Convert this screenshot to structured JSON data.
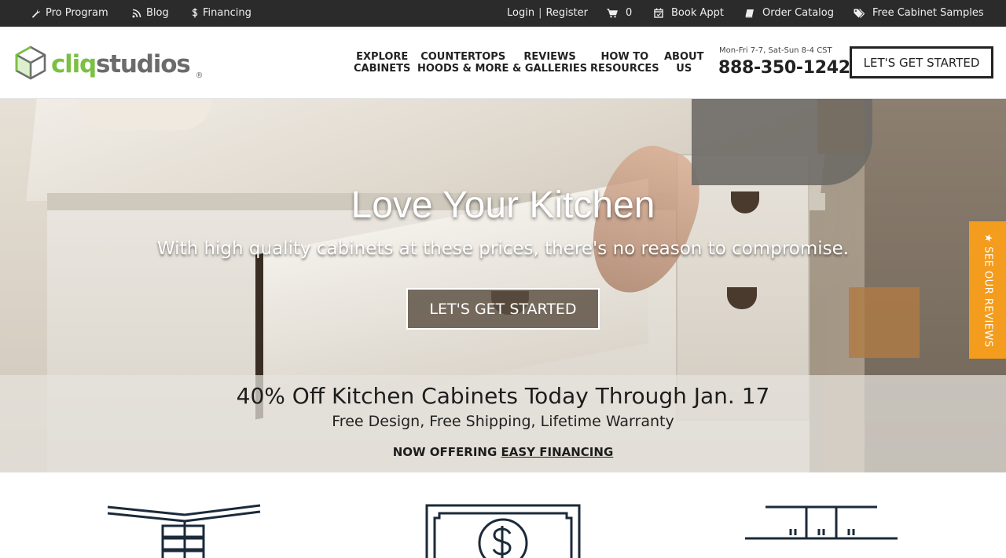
{
  "topbar": {
    "pro_program": "Pro Program",
    "blog": "Blog",
    "financing": "Financing",
    "login": "Login",
    "separator": "|",
    "register": "Register",
    "cart_count": "0",
    "book_appt": "Book Appt",
    "order_catalog": "Order Catalog",
    "free_samples": "Free Cabinet Samples",
    "icons": [
      "wrench-icon",
      "rss-icon",
      "dollar-icon",
      "cart-icon",
      "calendar-icon",
      "book-icon",
      "tags-icon"
    ]
  },
  "header": {
    "logo_cliq": "cliq",
    "logo_studios": "studios",
    "logo_reg": "®",
    "nav": [
      {
        "line1": "Explore",
        "line2": "Cabinets"
      },
      {
        "line1": "Countertops",
        "line2": "Hoods & More"
      },
      {
        "line1": "Reviews",
        "line2": "& Galleries"
      },
      {
        "line1": "How To",
        "line2": "Resources"
      },
      {
        "line1": "About",
        "line2": "Us"
      }
    ],
    "hours": "Mon-Fri 7-7, Sat-Sun 8-4 CST",
    "phone": "888-350-1242",
    "cta": "Let's Get Started"
  },
  "hero": {
    "title": "Love Your Kitchen",
    "subtitle": "With high quality cabinets at these prices, there's no reason to compromise.",
    "cta": "Let's Get Started"
  },
  "promo": {
    "title": "40% Off Kitchen Cabinets Today Through Jan. 17",
    "subtitle": "Free Design, Free Shipping, Lifetime Warranty",
    "financing_prefix": "Now Offering",
    "financing_link": "Easy Financing"
  },
  "reviews_tab": {
    "star": "★",
    "label": "See Our Reviews"
  },
  "colors": {
    "brand_green": "#7ac143",
    "logo_gray": "#6b6b6b",
    "topbar_bg": "#2b2b2b",
    "reviews_orange": "#f39c1e",
    "icon_navy": "#1b2a3a"
  }
}
